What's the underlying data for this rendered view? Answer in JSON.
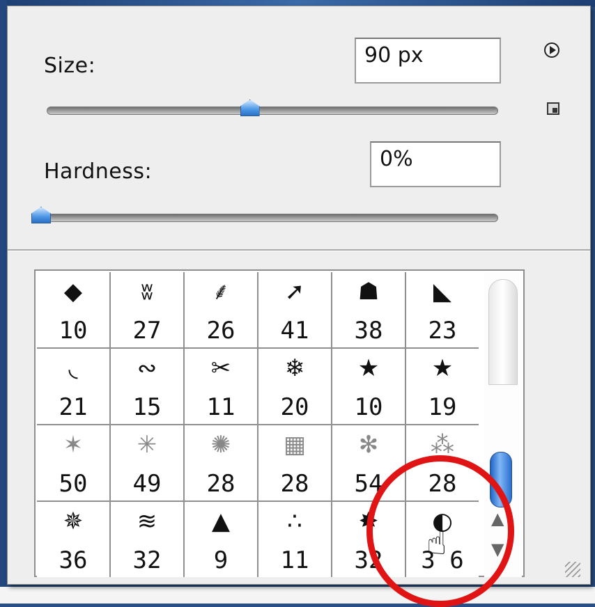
{
  "size": {
    "label": "Size:",
    "value": "90 px",
    "slider_fraction": 0.45
  },
  "hardness": {
    "label": "Hardness:",
    "value": "0%",
    "slider_fraction": 0.0
  },
  "brushes": [
    {
      "glyph": "◆",
      "value": "10"
    },
    {
      "glyph": "ʬ",
      "value": "27"
    },
    {
      "glyph": "⸙",
      "value": "26"
    },
    {
      "glyph": "➚",
      "value": "41"
    },
    {
      "glyph": "☗",
      "value": "38"
    },
    {
      "glyph": "◣",
      "value": "23"
    },
    {
      "glyph": "◟",
      "value": "21"
    },
    {
      "glyph": "∾",
      "value": "15"
    },
    {
      "glyph": "✂",
      "value": "11"
    },
    {
      "glyph": "❄",
      "value": "20"
    },
    {
      "glyph": "★",
      "value": "10"
    },
    {
      "glyph": "★",
      "value": "19"
    },
    {
      "glyph": "✶",
      "value": "50"
    },
    {
      "glyph": "✳",
      "value": "49"
    },
    {
      "glyph": "✺",
      "value": "28"
    },
    {
      "glyph": "▦",
      "value": "28"
    },
    {
      "glyph": "✻",
      "value": "54"
    },
    {
      "glyph": "⁂",
      "value": "28"
    },
    {
      "glyph": "✵",
      "value": "36"
    },
    {
      "glyph": "≋",
      "value": "32"
    },
    {
      "glyph": "▲",
      "value": "9"
    },
    {
      "glyph": "∴",
      "value": "11"
    },
    {
      "glyph": "✸",
      "value": "32"
    },
    {
      "glyph": "◐",
      "value": "3 6"
    }
  ],
  "icons": {
    "menu": "play-circle-icon",
    "new_preset": "new-preset-icon",
    "scroll_up": "▲",
    "scroll_down": "▼",
    "cursor": "hand-pointer-icon"
  },
  "colors": {
    "highlight": "#e01414",
    "thumb": "#4c97e6"
  }
}
